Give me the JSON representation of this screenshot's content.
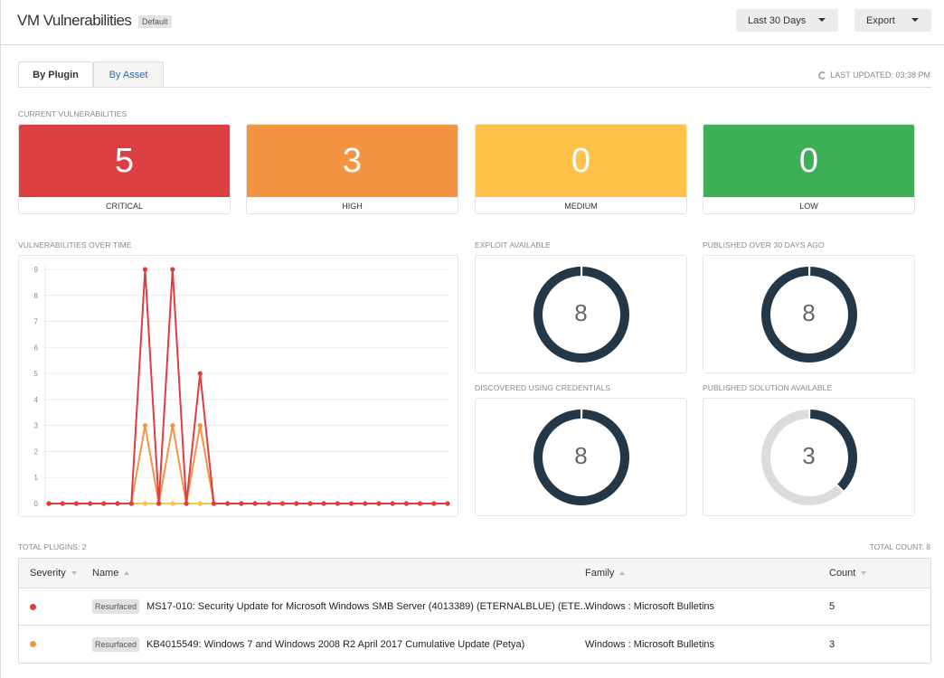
{
  "header": {
    "title": "VM Vulnerabilities",
    "badge": "Default",
    "range_button": "Last 30 Days",
    "export_button": "Export"
  },
  "tabs": [
    {
      "label": "By Plugin",
      "active": true
    },
    {
      "label": "By Asset",
      "active": false
    }
  ],
  "last_updated": "LAST UPDATED: 03:38 PM",
  "current_vulnerabilities": {
    "label": "CURRENT VULNERABILITIES",
    "cards": [
      {
        "label": "CRITICAL",
        "value": "5",
        "color": "#dc3e42"
      },
      {
        "label": "HIGH",
        "value": "3",
        "color": "#f39443"
      },
      {
        "label": "MEDIUM",
        "value": "0",
        "color": "#fec24a"
      },
      {
        "label": "LOW",
        "value": "0",
        "color": "#3daf57"
      }
    ]
  },
  "chart_data": {
    "type": "line",
    "title": "VULNERABILITIES OVER TIME",
    "xlabel": "",
    "ylabel": "",
    "ylim": [
      0,
      9
    ],
    "yticks": [
      "0",
      "1",
      "2",
      "3",
      "4",
      "5",
      "6",
      "7",
      "8",
      "9"
    ],
    "grid": true,
    "x": [
      1,
      2,
      3,
      4,
      5,
      6,
      7,
      8,
      9,
      10,
      11,
      12,
      13,
      14,
      15,
      16,
      17,
      18,
      19,
      20,
      21,
      22,
      23,
      24,
      25,
      26,
      27,
      28,
      29,
      30
    ],
    "series": [
      {
        "name": "Medium",
        "color": "#fec24a",
        "values": [
          0,
          0,
          0,
          0,
          0,
          0,
          0,
          0,
          0,
          0,
          0,
          0,
          0,
          0,
          0,
          0,
          0,
          0,
          0,
          0,
          0,
          0,
          0,
          0,
          0,
          0,
          0,
          0,
          0,
          0
        ]
      },
      {
        "name": "High",
        "color": "#f39443",
        "values": [
          0,
          0,
          0,
          0,
          0,
          0,
          0,
          3,
          0,
          3,
          0,
          3,
          0,
          0,
          0,
          0,
          0,
          0,
          0,
          0,
          0,
          0,
          0,
          0,
          0,
          0,
          0,
          0,
          0,
          0
        ]
      },
      {
        "name": "Critical",
        "color": "#dc3e42",
        "values": [
          0,
          0,
          0,
          0,
          0,
          0,
          0,
          9,
          0,
          9,
          0,
          5,
          0,
          0,
          0,
          0,
          0,
          0,
          0,
          0,
          0,
          0,
          0,
          0,
          0,
          0,
          0,
          0,
          0,
          0
        ]
      }
    ]
  },
  "donuts": [
    {
      "label": "EXPLOIT AVAILABLE",
      "value": "8",
      "fraction": 1.0
    },
    {
      "label": "PUBLISHED OVER 30 DAYS AGO",
      "value": "8",
      "fraction": 1.0
    },
    {
      "label": "DISCOVERED USING CREDENTIALS",
      "value": "8",
      "fraction": 1.0
    },
    {
      "label": "PUBLISHED SOLUTION AVAILABLE",
      "value": "3",
      "fraction": 0.375
    }
  ],
  "donut_colors": {
    "fill": "#243746",
    "track": "#dcdcdc"
  },
  "table": {
    "total_plugins": "TOTAL PLUGINS: 2",
    "total_count": "TOTAL COUNT: 8",
    "columns": [
      "Severity",
      "Name",
      "Family",
      "Count"
    ],
    "rows": [
      {
        "severity_color": "#dc3e42",
        "tag": "Resurfaced",
        "name": "MS17-010: Security Update for Microsoft Windows SMB Server (4013389) (ETERNALBLUE) (ETE...",
        "family": "Windows : Microsoft Bulletins",
        "count": "5"
      },
      {
        "severity_color": "#f39443",
        "tag": "Resurfaced",
        "name": "KB4015549: Windows 7 and Windows 2008 R2 April 2017 Cumulative Update (Petya)",
        "family": "Windows : Microsoft Bulletins",
        "count": "3"
      }
    ]
  }
}
